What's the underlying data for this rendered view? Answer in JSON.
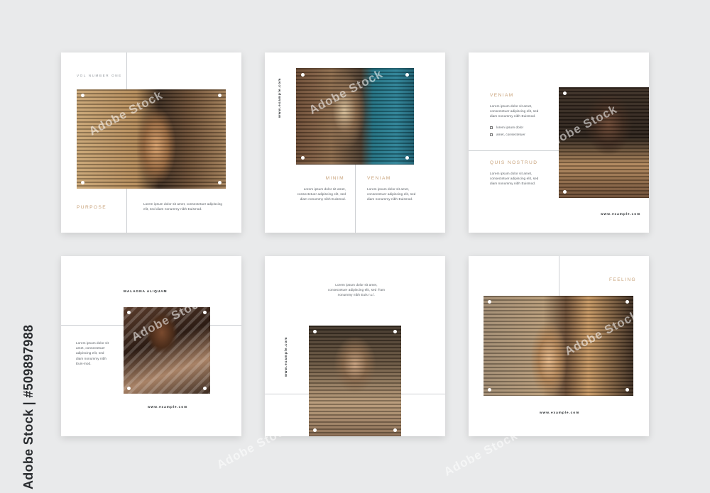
{
  "brand_colors": {
    "background": "#e9eaeb",
    "card": "#ffffff",
    "gold": "#c8a27a",
    "rule": "#cdd0d3"
  },
  "side_text": "Adobe Stock | #509897988",
  "watermark": "Adobe Stock",
  "templates": [
    {
      "kicker": "VOL NUMBER ONE",
      "title": "PURPOSE",
      "body": "Lorem ipsum dolor sit amet, consectetuer adipiscing elit, sed diam nonummy nibh Euismod."
    },
    {
      "url": "www.example.com",
      "col1_title": "MINIM",
      "col1_body": "Lorem ipsum dolor sit amet, consectetuer adipiscing elit, sed diam nonummy nibh Euismod.",
      "col2_title": "VENIAM",
      "col2_body": "Lorem ipsum dolor sit amet, consectetuer adipiscing elit, sed diam nonummy nibh Euismod."
    },
    {
      "title1": "VENIAM",
      "body1": "Lorem ipsum dolor sit amet, consectetuer adipiscing elit, sed diam nonummy nibh Euismod.",
      "list": [
        "lorem ipsum dolor",
        "amet, consectetuer"
      ],
      "title2": "QUIS NOSTRUD",
      "body2": "Lorem ipsum dolor sit amet, consectetuer adipiscing elit, sed diam nonummy nibh Euismod.",
      "url": "www.example.com"
    },
    {
      "title": "MALAGNA ALIQUAM",
      "body": "Lorem ipsum dolor sit amet, consectetuer adipiscing elit, sed diam nonummy nibh Euis-mod.",
      "url": "www.example.com"
    },
    {
      "body": "Lorem ipsum dolor sit amet, consectetuer adipiscing elit, sed diam nonummy nibh Euismod.",
      "url": "www.example.com"
    },
    {
      "title": "FEELING",
      "url": "www.example.com"
    }
  ]
}
